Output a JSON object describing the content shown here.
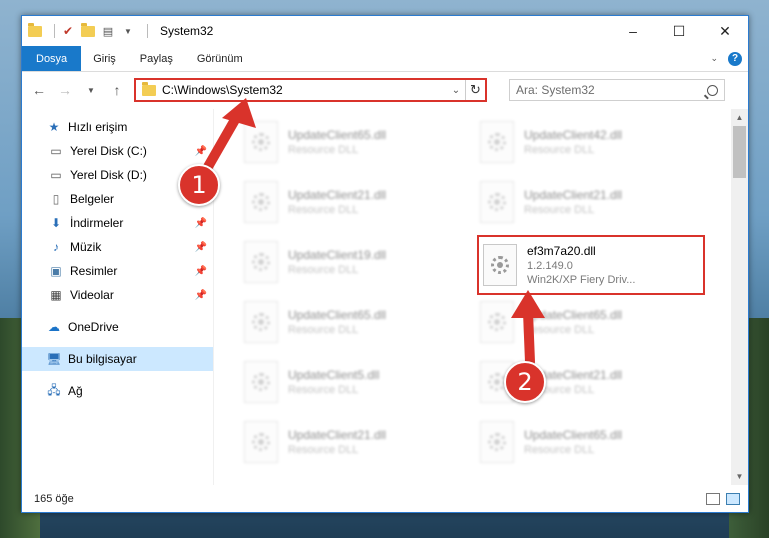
{
  "titlebar": {
    "title": "System32",
    "controls": [
      "–",
      "☐",
      "✕"
    ]
  },
  "ribbon": {
    "tabs": [
      "Dosya",
      "Giriş",
      "Paylaş",
      "Görünüm"
    ],
    "help": "?"
  },
  "navbar": {
    "address": "C:\\Windows\\System32",
    "search_placeholder": "Ara: System32"
  },
  "sidebar": {
    "quick_access": "Hızlı erişim",
    "items": [
      {
        "label": "Yerel Disk (C:)",
        "icon": "drive-icon"
      },
      {
        "label": "Yerel Disk (D:)",
        "icon": "drive-icon"
      },
      {
        "label": "Belgeler",
        "icon": "documents-icon"
      },
      {
        "label": "İndirmeler",
        "icon": "download-icon"
      },
      {
        "label": "Müzik",
        "icon": "music-icon"
      },
      {
        "label": "Resimler",
        "icon": "pictures-icon"
      },
      {
        "label": "Videolar",
        "icon": "videos-icon"
      }
    ],
    "onedrive": "OneDrive",
    "this_pc": "Bu bilgisayar",
    "network": "Ağ"
  },
  "files": {
    "left": [
      {
        "name": "UpdateClient65.dll",
        "type": "Resource DLL"
      },
      {
        "name": "UpdateClient21.dll",
        "type": "Resource DLL"
      },
      {
        "name": "UpdateClient19.dll",
        "type": "Resource DLL"
      },
      {
        "name": "UpdateClient65.dll",
        "type": "Resource DLL"
      },
      {
        "name": "UpdateClient5.dll",
        "type": "Resource DLL"
      },
      {
        "name": "UpdateClient21.dll",
        "type": "Resource DLL"
      }
    ],
    "right": [
      {
        "name": "UpdateClient42.dll",
        "type": "Resource DLL"
      },
      {
        "name": "UpdateClient21.dll",
        "type": "Resource DLL"
      },
      {
        "name": "ef3m7a20.dll",
        "version": "1.2.149.0",
        "type": "Win2K/XP Fiery Driv..."
      },
      {
        "name": "UpdateClient65.dll",
        "type": "Resource DLL"
      },
      {
        "name": "UpdateClient21.dll",
        "type": "Resource DLL"
      },
      {
        "name": "UpdateClient65.dll",
        "type": "Resource DLL"
      }
    ]
  },
  "status": {
    "count": "165 öğe"
  },
  "annotations": {
    "step1": "1",
    "step2": "2",
    "color": "#d9332b"
  }
}
